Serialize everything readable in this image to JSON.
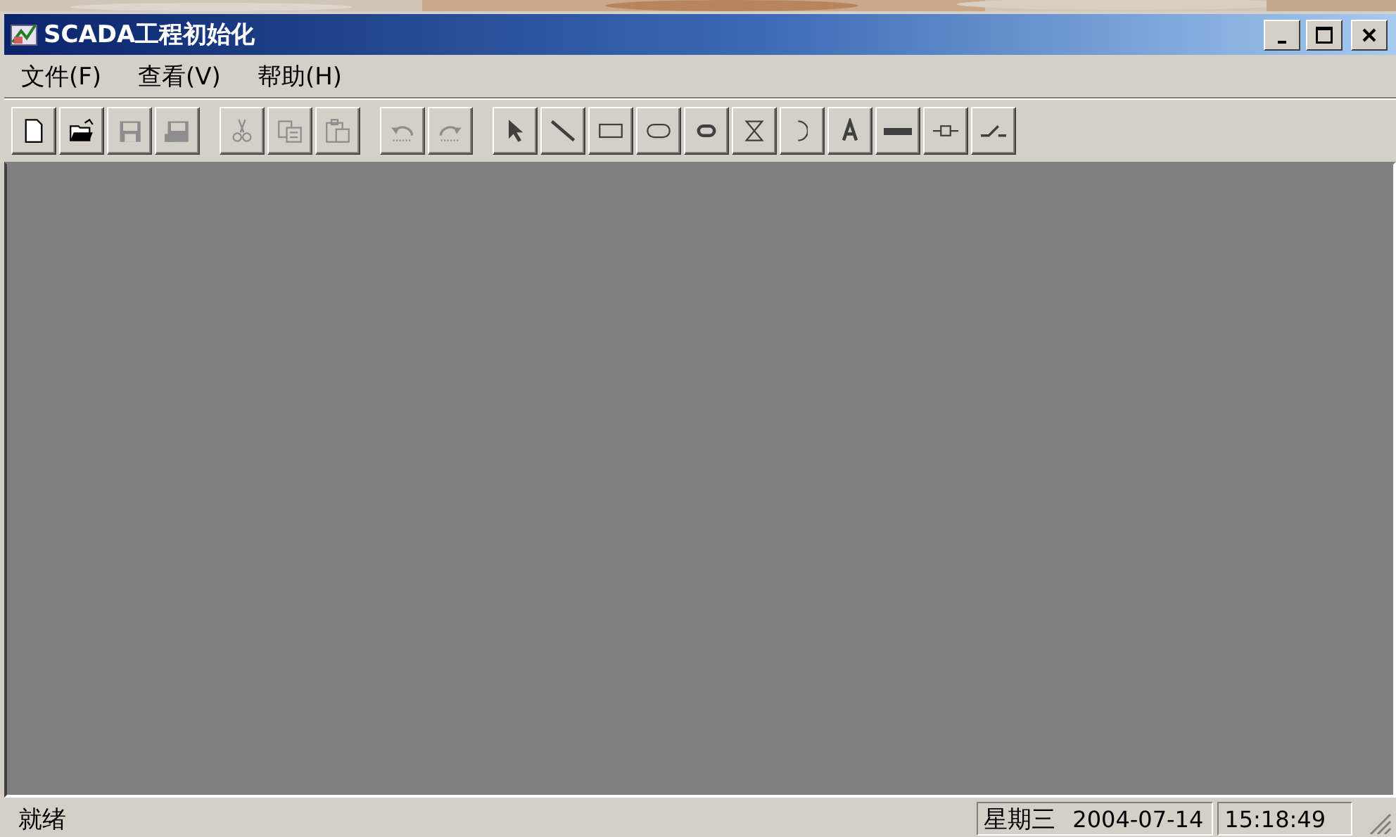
{
  "window": {
    "title": "SCADA工程初始化"
  },
  "menu": [
    {
      "label": "文件(F)"
    },
    {
      "label": "查看(V)"
    },
    {
      "label": "帮助(H)"
    }
  ],
  "toolbar": [
    {
      "kind": "new",
      "disabled": false
    },
    {
      "kind": "open",
      "disabled": false
    },
    {
      "kind": "save",
      "disabled": true
    },
    {
      "kind": "save-all",
      "disabled": true
    },
    {
      "kind": "separator"
    },
    {
      "kind": "cut",
      "disabled": true
    },
    {
      "kind": "copy",
      "disabled": true
    },
    {
      "kind": "paste",
      "disabled": true
    },
    {
      "kind": "separator"
    },
    {
      "kind": "undo",
      "disabled": true
    },
    {
      "kind": "redo",
      "disabled": true
    },
    {
      "kind": "separator"
    },
    {
      "kind": "pointer",
      "disabled": false
    },
    {
      "kind": "line",
      "disabled": false
    },
    {
      "kind": "rect",
      "disabled": false
    },
    {
      "kind": "roundrect",
      "disabled": false
    },
    {
      "kind": "capsule",
      "disabled": false
    },
    {
      "kind": "hourglass",
      "disabled": false
    },
    {
      "kind": "arc",
      "disabled": false
    },
    {
      "kind": "text",
      "disabled": false
    },
    {
      "kind": "bar",
      "disabled": false
    },
    {
      "kind": "fuse",
      "disabled": false
    },
    {
      "kind": "switch",
      "disabled": false
    }
  ],
  "status_bar": {
    "message": "就绪",
    "weekday": "星期三",
    "date": "2004-07-14",
    "time": "15:18:49"
  }
}
